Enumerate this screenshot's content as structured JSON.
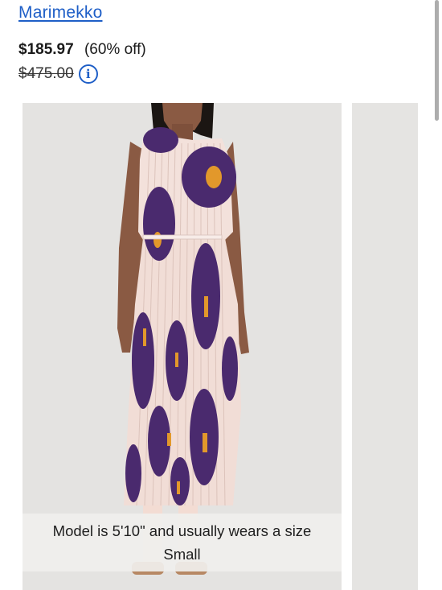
{
  "product": {
    "brand": "Marimekko",
    "sale_price": "$185.97",
    "discount": "(60% off)",
    "original_price": "$475.00"
  },
  "icons": {
    "info": "info-icon"
  },
  "gallery": {
    "caption": "Model is 5'10\" and usually wears a size Small"
  },
  "colors": {
    "link": "#1f5fc7",
    "dress_purple": "#4a2a6e",
    "dress_orange": "#e2982b",
    "dress_pink": "#f3e1db"
  }
}
